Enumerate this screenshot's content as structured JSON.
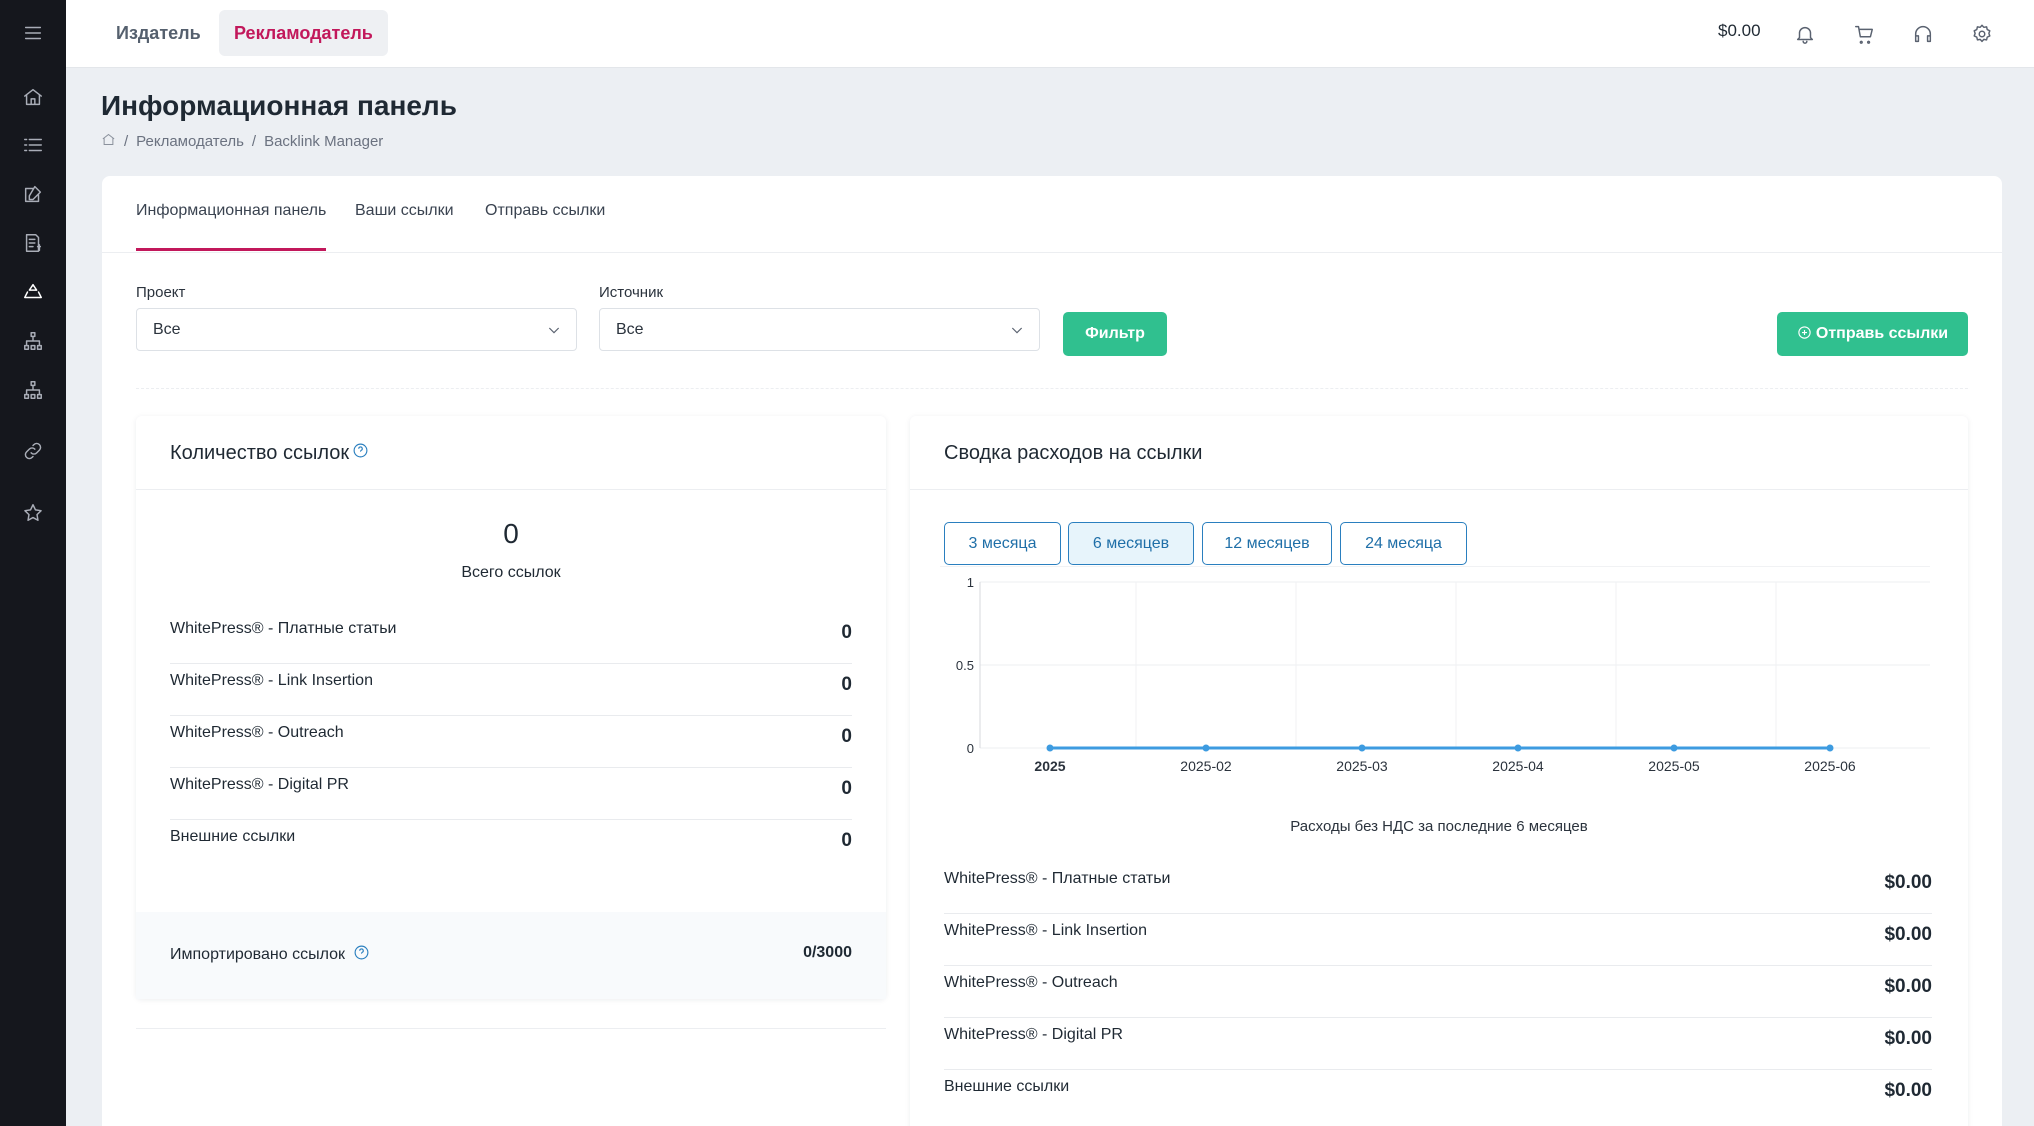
{
  "topbar": {
    "tabs": [
      {
        "label": "Издатель"
      },
      {
        "label": "Рекламодатель"
      }
    ],
    "balance": "$0.00"
  },
  "header": {
    "title": "Информационная панель",
    "breadcrumb": [
      "Рекламодатель",
      "Backlink Manager"
    ]
  },
  "tabs": [
    {
      "label": "Информационная панель"
    },
    {
      "label": "Ваши ссылки"
    },
    {
      "label": "Отправь ссылки"
    }
  ],
  "filters": {
    "project_label": "Проект",
    "project_value": "Все",
    "source_label": "Источник",
    "source_value": "Все",
    "filter_button": "Фильтр",
    "send_button": "Отправь ссылки"
  },
  "count_panel": {
    "title": "Количество ссылок",
    "total": "0",
    "total_label": "Всего ссылок",
    "rows": [
      {
        "label": "WhitePress® - Платные статьи",
        "value": "0"
      },
      {
        "label": "WhitePress® - Link Insertion",
        "value": "0"
      },
      {
        "label": "WhitePress® - Outreach",
        "value": "0"
      },
      {
        "label": "WhitePress® - Digital PR",
        "value": "0"
      },
      {
        "label": "Внешние ссылки",
        "value": "0"
      }
    ],
    "import_label": "Импортировано ссылок",
    "import_value": "0/3000"
  },
  "cost_panel": {
    "title": "Сводка расходов на ссылки",
    "periods": [
      {
        "label": "3 месяца"
      },
      {
        "label": "6 месяцев"
      },
      {
        "label": "12 месяцев"
      },
      {
        "label": "24 месяца"
      }
    ],
    "caption": "Расходы без НДС за последние 6 месяцев",
    "rows": [
      {
        "label": "WhitePress® - Платные статьи",
        "value": "$0.00"
      },
      {
        "label": "WhitePress® - Link Insertion",
        "value": "$0.00"
      },
      {
        "label": "WhitePress® - Outreach",
        "value": "$0.00"
      },
      {
        "label": "WhitePress® - Digital PR",
        "value": "$0.00"
      },
      {
        "label": "Внешние ссылки",
        "value": "$0.00"
      }
    ]
  },
  "chart_data": {
    "type": "line",
    "categories": [
      "2025",
      "2025-02",
      "2025-03",
      "2025-04",
      "2025-05",
      "2025-06"
    ],
    "values": [
      0,
      0,
      0,
      0,
      0,
      0
    ],
    "y_ticks": [
      "0",
      "0.5",
      "1"
    ],
    "ylim": [
      0,
      1
    ],
    "grid": true,
    "line_color": "#3d9be0"
  },
  "icons": {
    "sidebar": [
      "menu-icon",
      "home-icon",
      "list-icon",
      "edit-icon",
      "invoice-icon",
      "recycle-icon",
      "sitemap-icon",
      "sitemap-icon",
      "link-icon",
      "star-icon"
    ],
    "top": [
      "bell-icon",
      "cart-icon",
      "headset-icon",
      "gear-icon"
    ]
  }
}
